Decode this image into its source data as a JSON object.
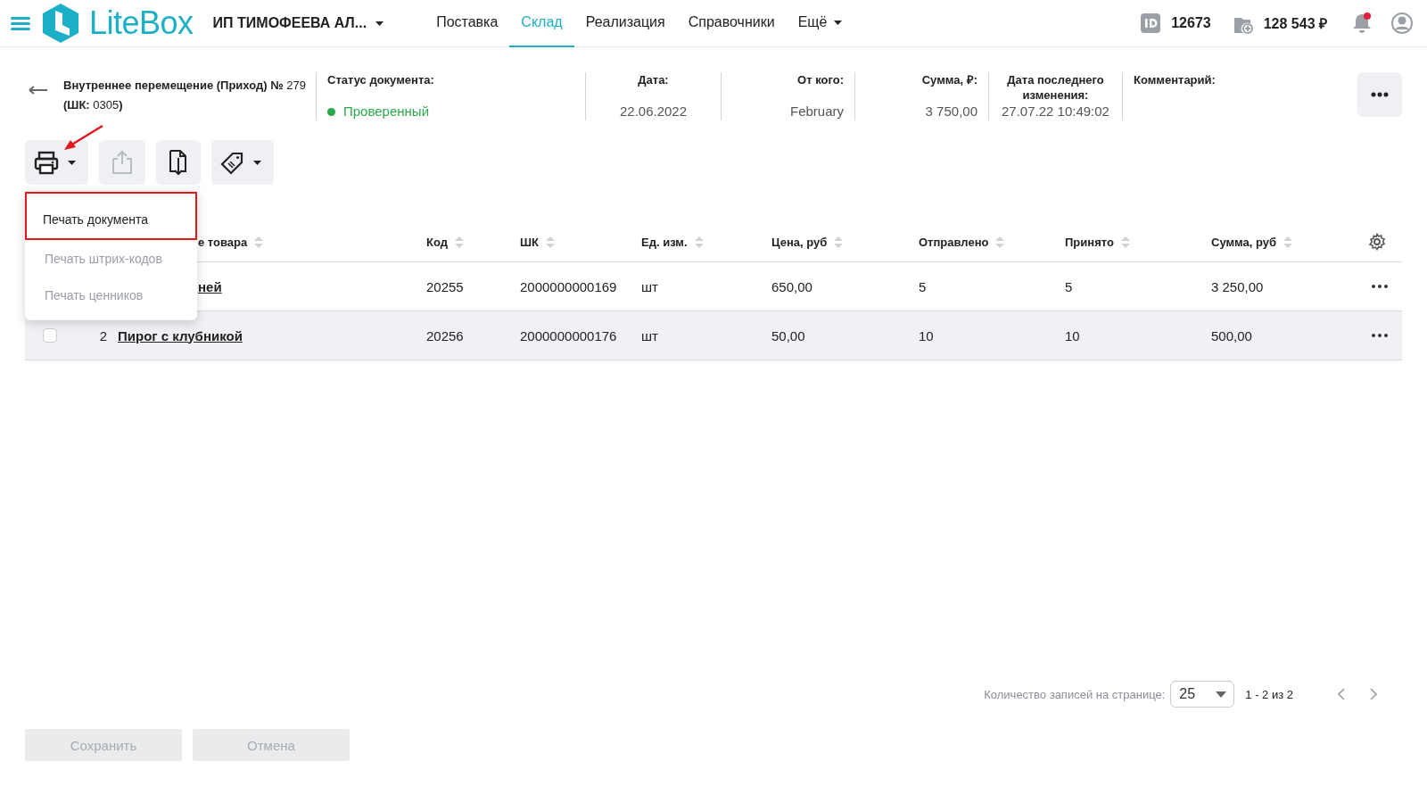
{
  "header": {
    "brand": "LiteBox",
    "company": "ИП ТИМОФЕЕВА АЛ...",
    "nav": [
      {
        "label": "Поставка",
        "selected": false,
        "kind": "link"
      },
      {
        "label": "Склад",
        "selected": true,
        "kind": "link"
      },
      {
        "label": "Реализация",
        "selected": false,
        "kind": "link"
      },
      {
        "label": "Справочники",
        "selected": false,
        "kind": "link"
      },
      {
        "label": "Ещё",
        "selected": false,
        "kind": "dropdown"
      }
    ],
    "account_id": "12673",
    "balance": "128 543 ₽",
    "unread_notifications": true
  },
  "document": {
    "title": "**Внутреннее перемещение (Приход) №** 279 **(ШК:** 0305**)**",
    "fields": [
      {
        "kind": "status",
        "label": "Статус документа:",
        "value": "Проверенный",
        "color": "#2ca84a"
      },
      {
        "kind": "date",
        "label": "Дата:",
        "value": "22.06.2022"
      },
      {
        "kind": "party",
        "label": "От кого:",
        "value": "February"
      },
      {
        "kind": "amount",
        "label": "Сумма, ₽:",
        "value": "3 750,00"
      },
      {
        "kind": "timestamp",
        "label": "Дата последнего изменения:",
        "value": "27.07.22 10:49:02"
      },
      {
        "kind": "comment",
        "label": "Комментарий:"
      }
    ]
  },
  "toolbar": [
    {
      "kind": "print",
      "dropdown": true,
      "disabled": false
    },
    {
      "kind": "upload",
      "dropdown": false,
      "disabled": true
    },
    {
      "kind": "download",
      "dropdown": false,
      "disabled": false
    },
    {
      "kind": "tag",
      "dropdown": true,
      "disabled": false
    }
  ],
  "print_menu": {
    "items": [
      {
        "label": "Печать документа",
        "disabled": false,
        "highlighted": true
      },
      {
        "label": "Печать штрих-кодов",
        "disabled": true,
        "highlighted": false
      },
      {
        "label": "Печать ценников",
        "disabled": true,
        "highlighted": false
      }
    ]
  },
  "table": {
    "columns": [
      "е товара",
      "Код",
      "ШК",
      "Ед. изм.",
      "Цена, руб",
      "Отправлено",
      "Принято",
      "Сумма, руб"
    ],
    "rows": [
      {
        "name": "ней",
        "code": "20255",
        "barcode": "2000000000169",
        "unit": "шт",
        "price": "650,00",
        "sent": "5",
        "received": "5",
        "sum": "3 250,00",
        "highlighted": false
      },
      {
        "checked": false,
        "number": "2",
        "name": "Пирог с клубникой",
        "code": "20256",
        "barcode": "2000000000176",
        "unit": "шт",
        "price": "50,00",
        "sent": "10",
        "received": "10",
        "sum": "500,00",
        "highlighted": true
      }
    ]
  },
  "pager": {
    "label": "Количество записей на странице:",
    "page_size": "25",
    "range": "1 - 2 из 2"
  },
  "actions": [
    {
      "label": "Сохранить",
      "disabled": true
    },
    {
      "label": "Отмена",
      "disabled": true
    }
  ]
}
